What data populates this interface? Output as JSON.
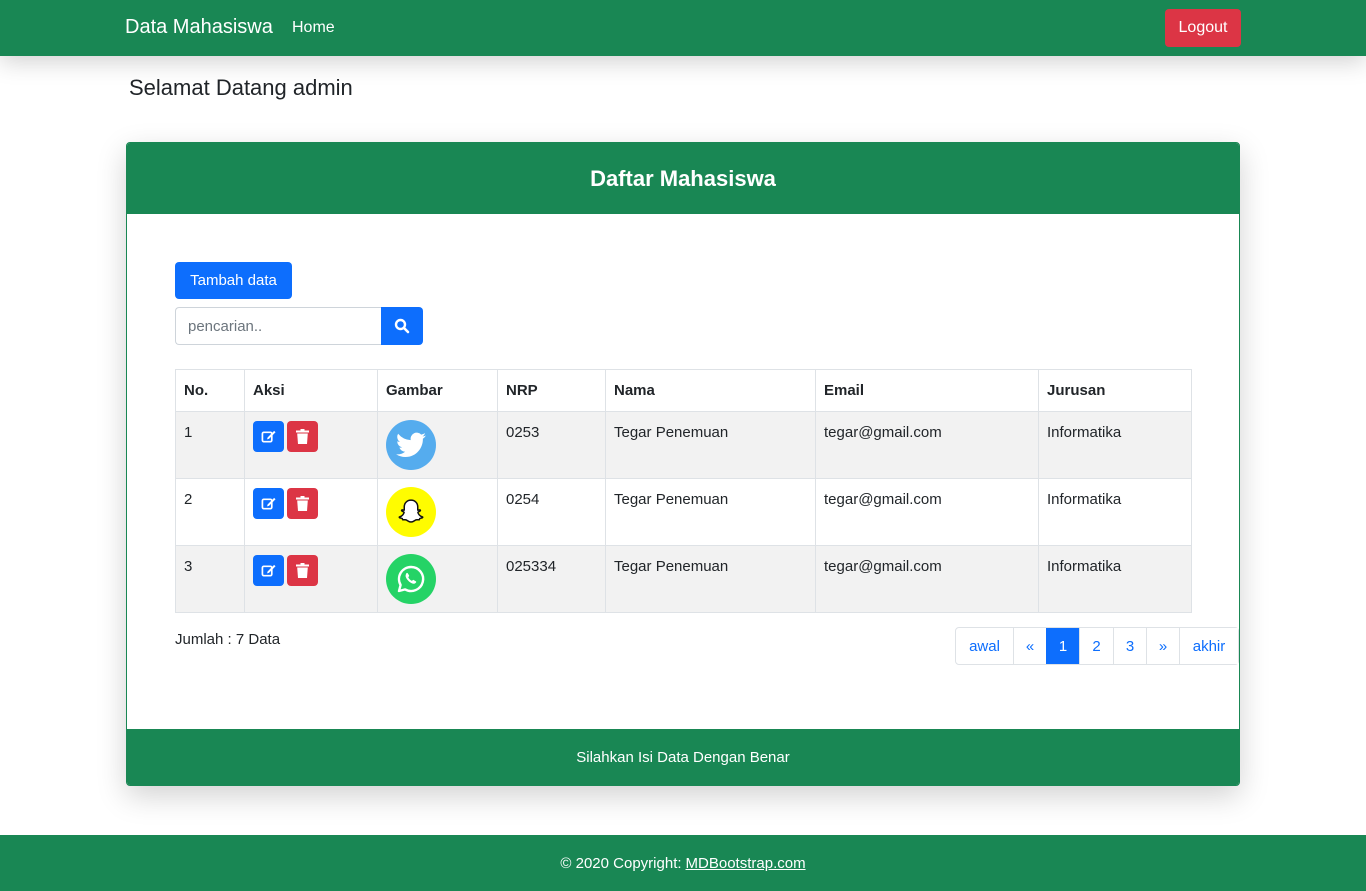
{
  "navbar": {
    "brand": "Data Mahasiswa",
    "home_label": "Home",
    "logout_label": "Logout"
  },
  "welcome_text": "Selamat Datang admin",
  "card": {
    "title": "Daftar Mahasiswa",
    "footer_text": "Silahkan Isi Data Dengan Benar"
  },
  "toolbar": {
    "add_label": "Tambah data",
    "search_placeholder": "pencarian.."
  },
  "table": {
    "headers": [
      "No.",
      "Aksi",
      "Gambar",
      "NRP",
      "Nama",
      "Email",
      "Jurusan"
    ],
    "rows": [
      {
        "no": "1",
        "image": "twitter-icon",
        "nrp": "0253",
        "nama": "Tegar Penemuan",
        "email": "tegar@gmail.com",
        "jurusan": "Informatika"
      },
      {
        "no": "2",
        "image": "snapchat-icon",
        "nrp": "0254",
        "nama": "Tegar Penemuan",
        "email": "tegar@gmail.com",
        "jurusan": "Informatika"
      },
      {
        "no": "3",
        "image": "whatsapp-icon",
        "nrp": "025334",
        "nama": "Tegar Penemuan",
        "email": "tegar@gmail.com",
        "jurusan": "Informatika"
      }
    ]
  },
  "summary": "Jumlah : 7 Data",
  "pagination": {
    "items": [
      "awal",
      "«",
      "1",
      "2",
      "3",
      "»",
      "akhir"
    ],
    "active": "1"
  },
  "footer": {
    "copyright": "© 2020 Copyright:",
    "link_text": "MDBootstrap.com"
  },
  "colors": {
    "primary_green": "#198754",
    "primary_blue": "#0d6efd",
    "danger_red": "#dc3545"
  }
}
